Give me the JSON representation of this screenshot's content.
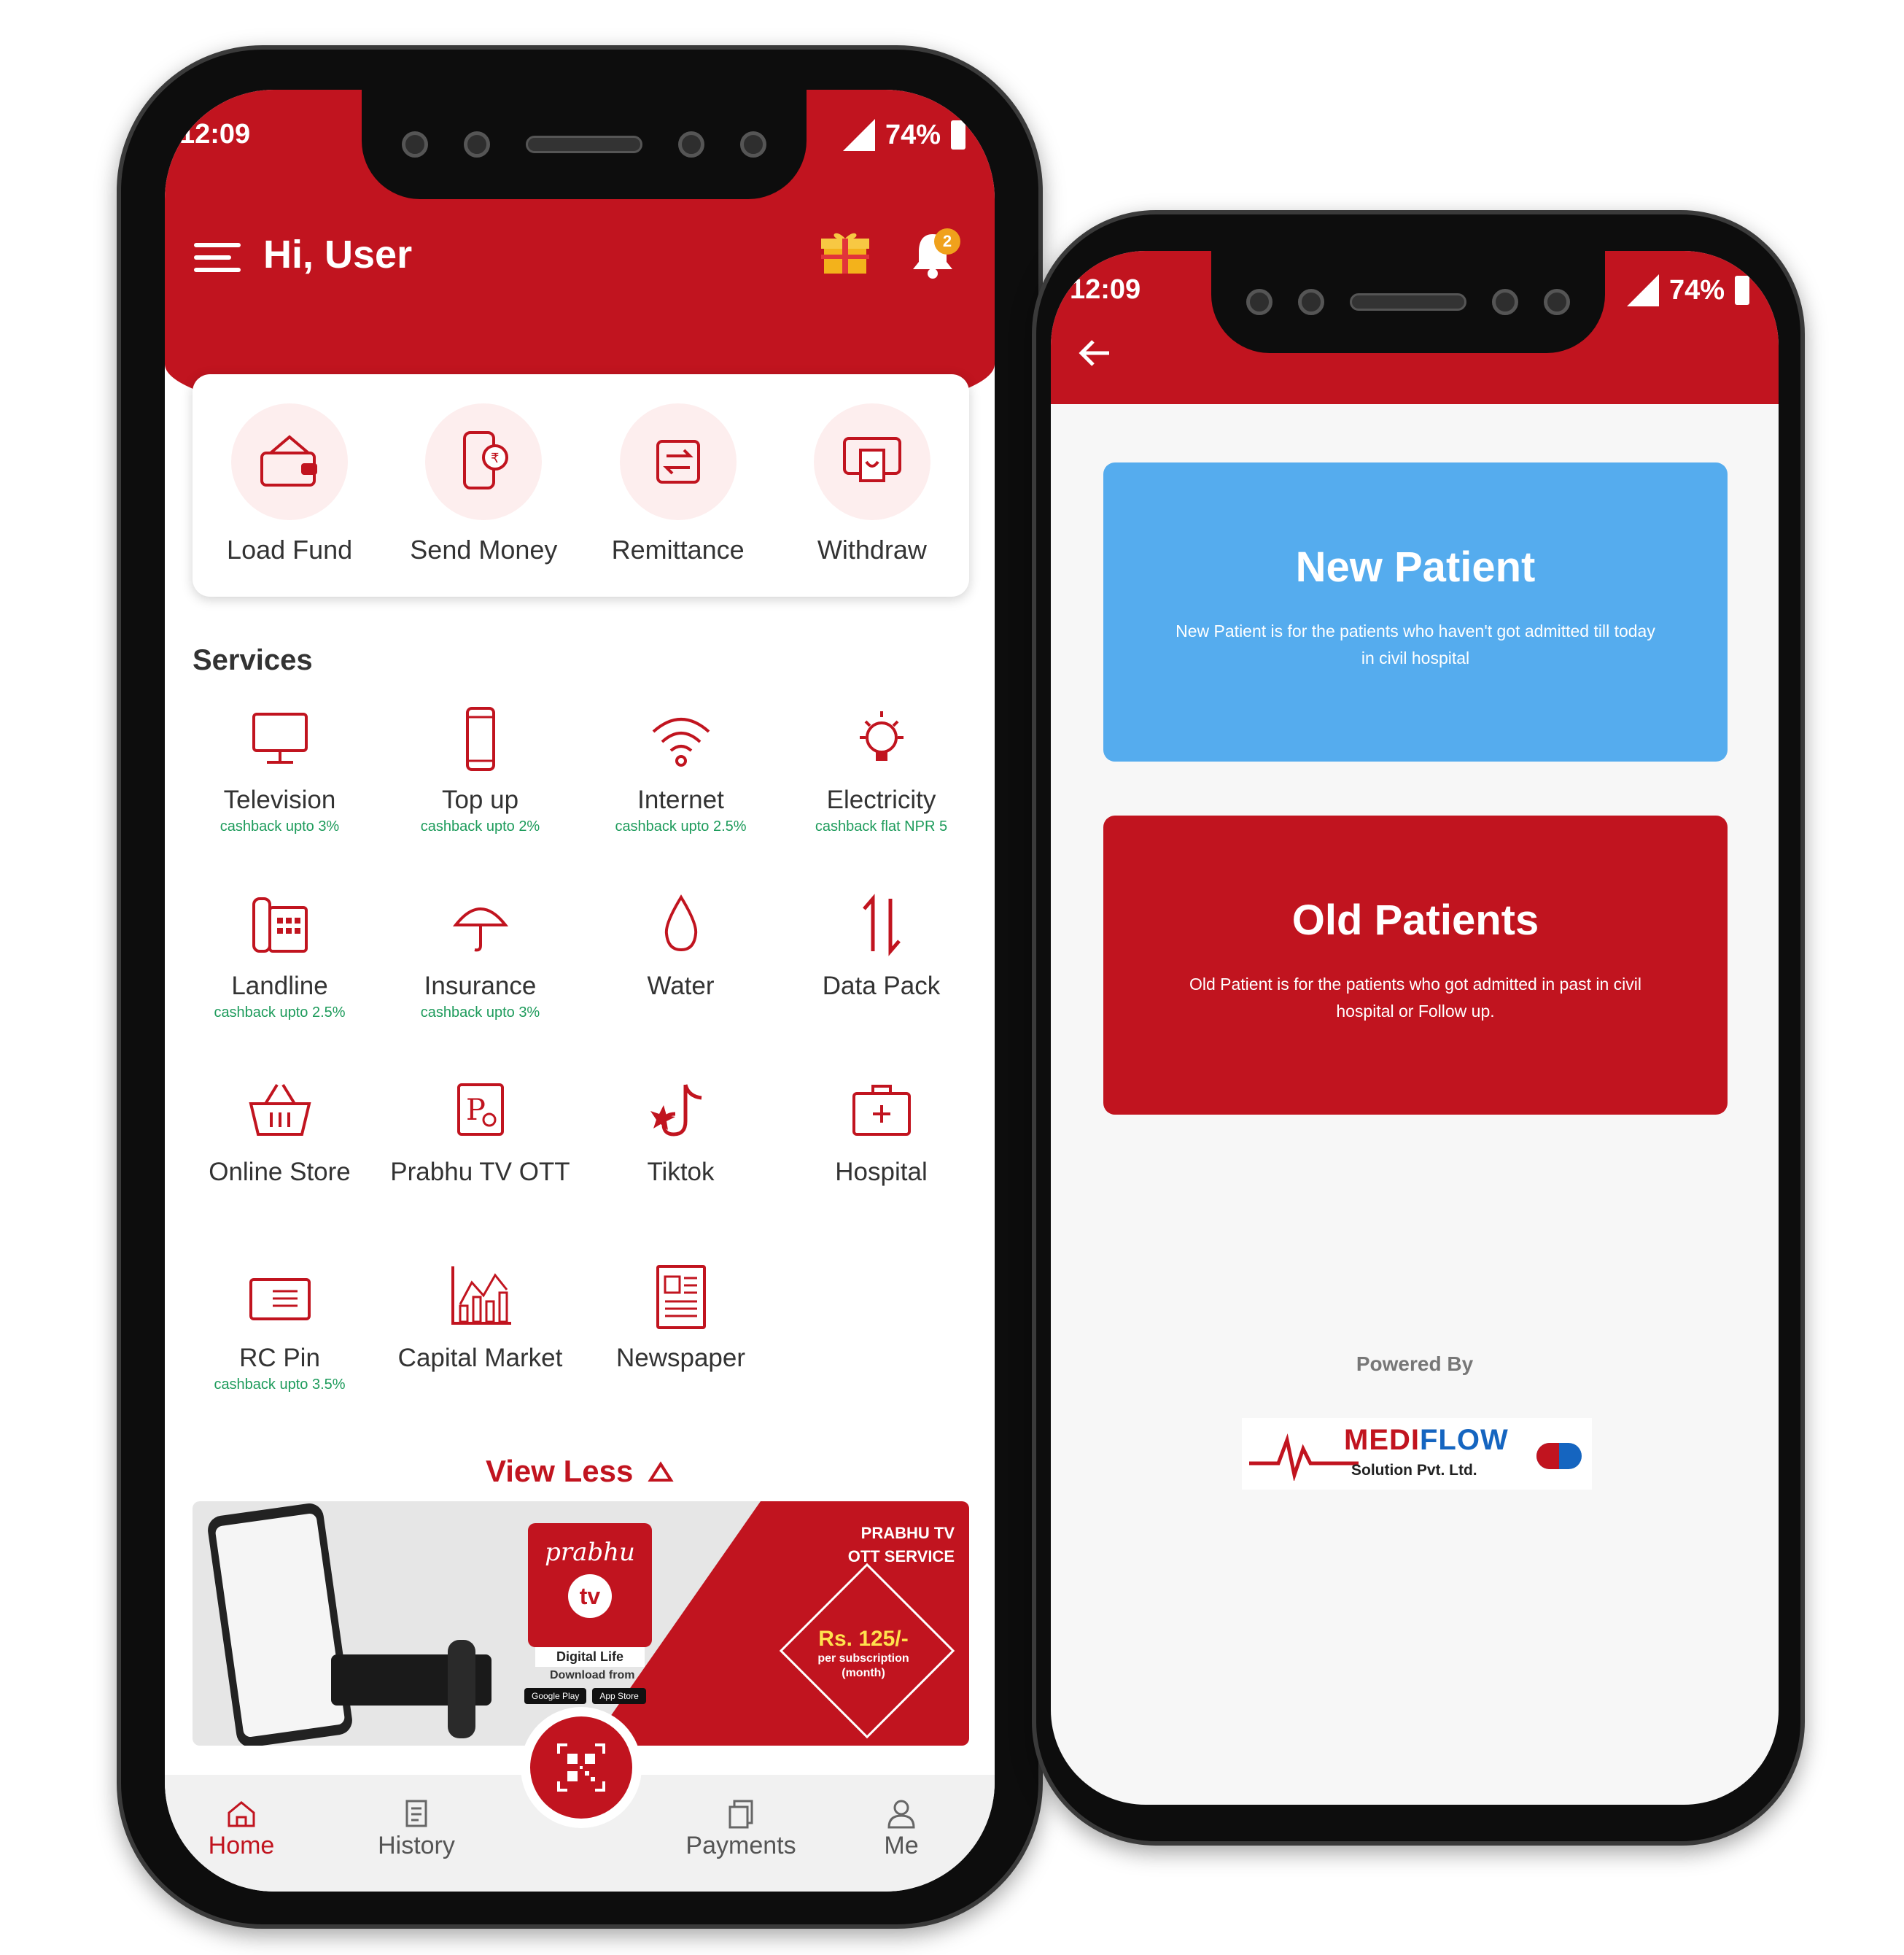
{
  "left_phone": {
    "status": {
      "time": "12:09",
      "battery": "74%"
    },
    "header": {
      "greeting": "Hi, User",
      "notification_count": "2"
    },
    "quick_actions": [
      {
        "label": "Load Fund",
        "icon": "wallet-icon"
      },
      {
        "label": "Send Money",
        "icon": "phone-money-icon"
      },
      {
        "label": "Remittance",
        "icon": "exchange-icon"
      },
      {
        "label": "Withdraw",
        "icon": "atm-icon"
      }
    ],
    "services_title": "Services",
    "services": [
      {
        "label": "Television",
        "cashback": "cashback upto 3%",
        "icon": "television-icon"
      },
      {
        "label": "Top up",
        "cashback": "cashback upto 2%",
        "icon": "mobile-icon"
      },
      {
        "label": "Internet",
        "cashback": "cashback upto 2.5%",
        "icon": "wifi-icon"
      },
      {
        "label": "Electricity",
        "cashback": "cashback flat NPR 5",
        "icon": "bulb-icon"
      },
      {
        "label": "Landline",
        "cashback": "cashback upto 2.5%",
        "icon": "telephone-icon"
      },
      {
        "label": "Insurance",
        "cashback": "cashback upto 3%",
        "icon": "umbrella-icon"
      },
      {
        "label": "Water",
        "cashback": "",
        "icon": "water-drop-icon"
      },
      {
        "label": "Data Pack",
        "cashback": "",
        "icon": "data-arrows-icon"
      },
      {
        "label": "Online Store",
        "cashback": "",
        "icon": "basket-icon"
      },
      {
        "label": "Prabhu TV OTT",
        "cashback": "",
        "icon": "prabhu-tv-icon"
      },
      {
        "label": "Tiktok",
        "cashback": "",
        "icon": "tiktok-icon"
      },
      {
        "label": "Hospital",
        "cashback": "",
        "icon": "medical-kit-icon"
      },
      {
        "label": "RC Pin",
        "cashback": "cashback upto 3.5%",
        "icon": "card-icon"
      },
      {
        "label": "Capital Market",
        "cashback": "",
        "icon": "bar-chart-icon"
      },
      {
        "label": "Newspaper",
        "cashback": "",
        "icon": "newspaper-icon"
      }
    ],
    "view_less": "View Less",
    "banner": {
      "logo_word": "prabhu",
      "logo_tv": "tv",
      "tagline": "Digital Life",
      "download": "Download from",
      "stores": [
        "Google Play",
        "App Store"
      ],
      "service_line1": "PRABHU TV",
      "service_line2": "OTT SERVICE",
      "price": "Rs. 125/-",
      "price_sub1": "per subscription",
      "price_sub2": "(month)"
    },
    "bottom_nav": {
      "home": "Home",
      "history": "History",
      "payments": "Payments",
      "me": "Me"
    }
  },
  "right_phone": {
    "status": {
      "time": "12:09",
      "battery": "74%"
    },
    "new_patient": {
      "title": "New Patient",
      "description": "New Patient is for the patients who haven't got admitted till today in civil hospital"
    },
    "old_patients": {
      "title": "Old Patients",
      "description": "Old Patient is for the patients who got admitted in past in civil hospital or Follow up."
    },
    "powered_by": "Powered By",
    "brand": {
      "name_part1": "MEDI",
      "name_part2": "FLOW",
      "subtitle": "Solution Pvt. Ltd."
    }
  },
  "colors": {
    "brand_red": "#c1141f",
    "new_patient_blue": "#55acee",
    "cashback_green": "#1d9b5b",
    "badge_orange": "#f0a11c"
  }
}
